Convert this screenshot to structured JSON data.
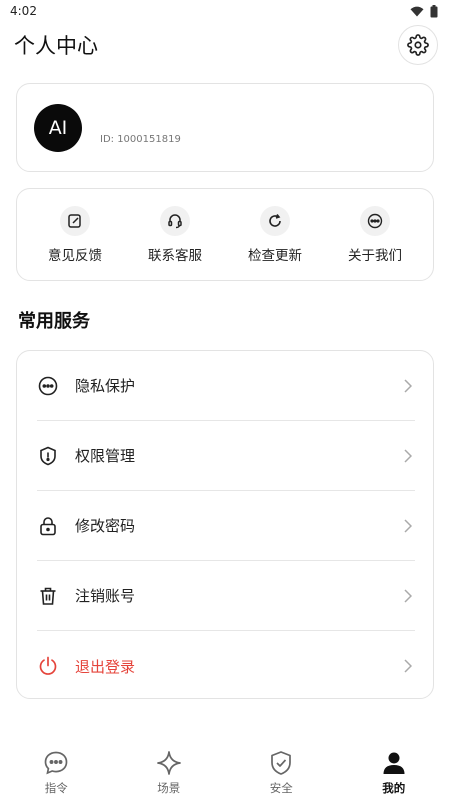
{
  "status_bar": {
    "time": "4:02"
  },
  "header": {
    "title": "个人中心"
  },
  "profile": {
    "avatar_text": "AI",
    "name": "",
    "id_text": "ID: 1000151819"
  },
  "quick_actions": [
    {
      "label": "意见反馈",
      "icon": "feedback-edit-icon"
    },
    {
      "label": "联系客服",
      "icon": "headset-icon"
    },
    {
      "label": "检查更新",
      "icon": "refresh-icon"
    },
    {
      "label": "关于我们",
      "icon": "more-dots-icon"
    }
  ],
  "services": {
    "title": "常用服务",
    "items": [
      {
        "label": "隐私保护",
        "icon": "privacy-dots-icon"
      },
      {
        "label": "权限管理",
        "icon": "shield-icon"
      },
      {
        "label": "修改密码",
        "icon": "lock-icon"
      },
      {
        "label": "注销账号",
        "icon": "trash-icon"
      },
      {
        "label": "退出登录",
        "icon": "power-icon",
        "color": "#e5443b"
      }
    ]
  },
  "tabs": [
    {
      "label": "指令",
      "icon": "chat-bubble-icon",
      "active": false
    },
    {
      "label": "场景",
      "icon": "sparkle-icon",
      "active": false
    },
    {
      "label": "安全",
      "icon": "shield-check-icon",
      "active": false
    },
    {
      "label": "我的",
      "icon": "person-icon",
      "active": true
    }
  ],
  "colors": {
    "danger": "#e5443b",
    "accent": "#111111"
  }
}
